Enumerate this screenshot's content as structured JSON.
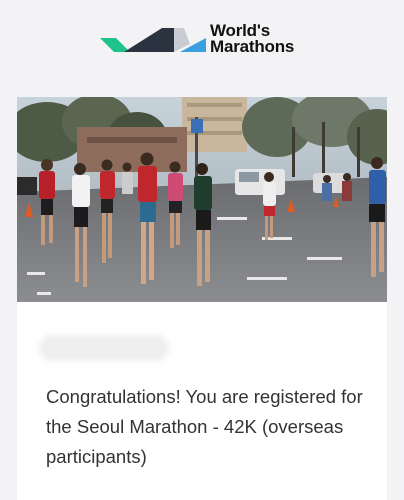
{
  "brand": {
    "line1": "World's",
    "line2": "Marathons",
    "icon": "worlds-marathons-logo-icon",
    "colors": {
      "green": "#1ec28b",
      "dark": "#2c3340",
      "blue": "#3b9fe0",
      "grey": "#c9ccd2"
    }
  },
  "hero": {
    "icon": "marathon-runners-photo"
  },
  "email": {
    "recipient_redacted": "",
    "message": "Congratulations! You are registered for the Seoul Marathon - 42K (overseas participants)"
  }
}
